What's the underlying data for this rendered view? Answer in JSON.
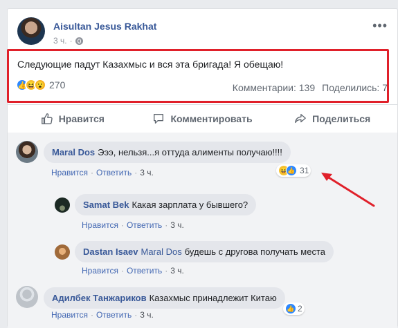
{
  "post": {
    "author": "Aisultan Jesus Rakhat",
    "time": "3 ч.",
    "text": "Следующие падут Казахмыс и вся эта бригада! Я обещаю!",
    "reaction_count": "270",
    "comments_label": "Комментарии: 139",
    "shares_label": "Поделились: 7"
  },
  "actions": {
    "like": "Нравится",
    "comment": "Комментировать",
    "share": "Поделиться"
  },
  "comments": [
    {
      "name": "Maral Dos",
      "text": "Эээ, нельзя...я оттуда алименты получаю!!!!",
      "like": "Нравится",
      "reply": "Ответить",
      "time": "3 ч.",
      "reaction_count": "31"
    },
    {
      "name": "Samat Bek",
      "text": "Какая зарплата у бывшего?",
      "like": "Нравится",
      "reply": "Ответить",
      "time": "3 ч."
    },
    {
      "name": "Dastan Isaev",
      "mention": "Maral Dos",
      "text": "будешь с другова получать места",
      "like": "Нравится",
      "reply": "Ответить",
      "time": "3 ч."
    },
    {
      "name": "Адилбек Танжариков",
      "text": "Казахмыс принадлежит Китаю",
      "like": "Нравится",
      "reply": "Ответить",
      "time": "3 ч.",
      "reaction_count": "2"
    }
  ],
  "colors": {
    "link": "#385898",
    "like_blue": "#2d88ff",
    "highlight_red": "#e0202a"
  },
  "icons": [
    "globe-icon",
    "more-options-icon",
    "like-reaction-icon",
    "haha-reaction-icon",
    "wow-reaction-icon",
    "thumbs-up-icon",
    "comment-icon",
    "share-icon",
    "annotation-arrow"
  ]
}
